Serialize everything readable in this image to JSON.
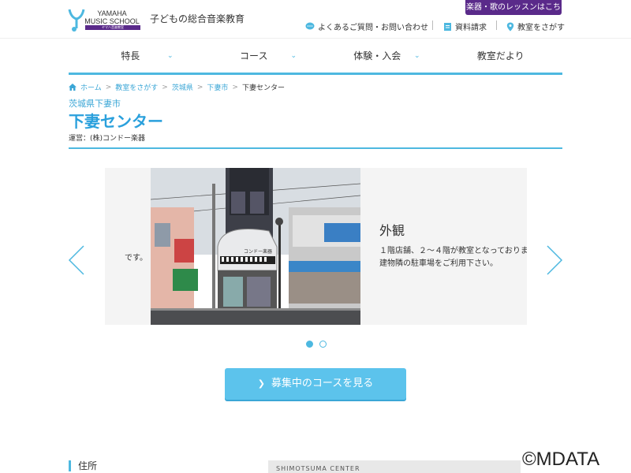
{
  "brand": {
    "logo_line1": "YAMAHA",
    "logo_line2": "MUSIC SCHOOL",
    "logo_bar": "ヤマハ音楽教室",
    "tagline": "子どもの総合音楽教育",
    "accent": "#4db8e0",
    "brand_purple": "#5a2a8a"
  },
  "header": {
    "cta_tab": "楽器・歌のレッスンはこちら",
    "util_faq": "よくあるご質問・お問い合わせ",
    "util_docs": "資料請求",
    "util_find": "教室をさがす"
  },
  "nav": {
    "items": [
      {
        "label": "特長"
      },
      {
        "label": "コース"
      },
      {
        "label": "体験・入会"
      },
      {
        "label": "教室だより"
      }
    ]
  },
  "breadcrumb": {
    "home": "ホーム",
    "find": "教室をさがす",
    "pref": "茨城県",
    "city": "下妻市",
    "current": "下妻センター"
  },
  "page": {
    "prefecture_city": "茨城県下妻市",
    "title": "下妻センター",
    "operator": "運営：(株)コンドー楽器"
  },
  "carousel": {
    "prev_text_tail": "です。",
    "heading": "外観",
    "desc_line1": "１階店舗、２～４階が教室となっておりま",
    "desc_line2": "建物隣の駐車場をご利用下さい。",
    "photo_sign": "コンドー楽器",
    "slides_total": 2,
    "active_index": 0
  },
  "cta": {
    "label": "募集中のコースを見る"
  },
  "address": {
    "heading": "住所",
    "map_text": "SHIMOTSUMA CENTER"
  },
  "watermark": "©MDATA"
}
